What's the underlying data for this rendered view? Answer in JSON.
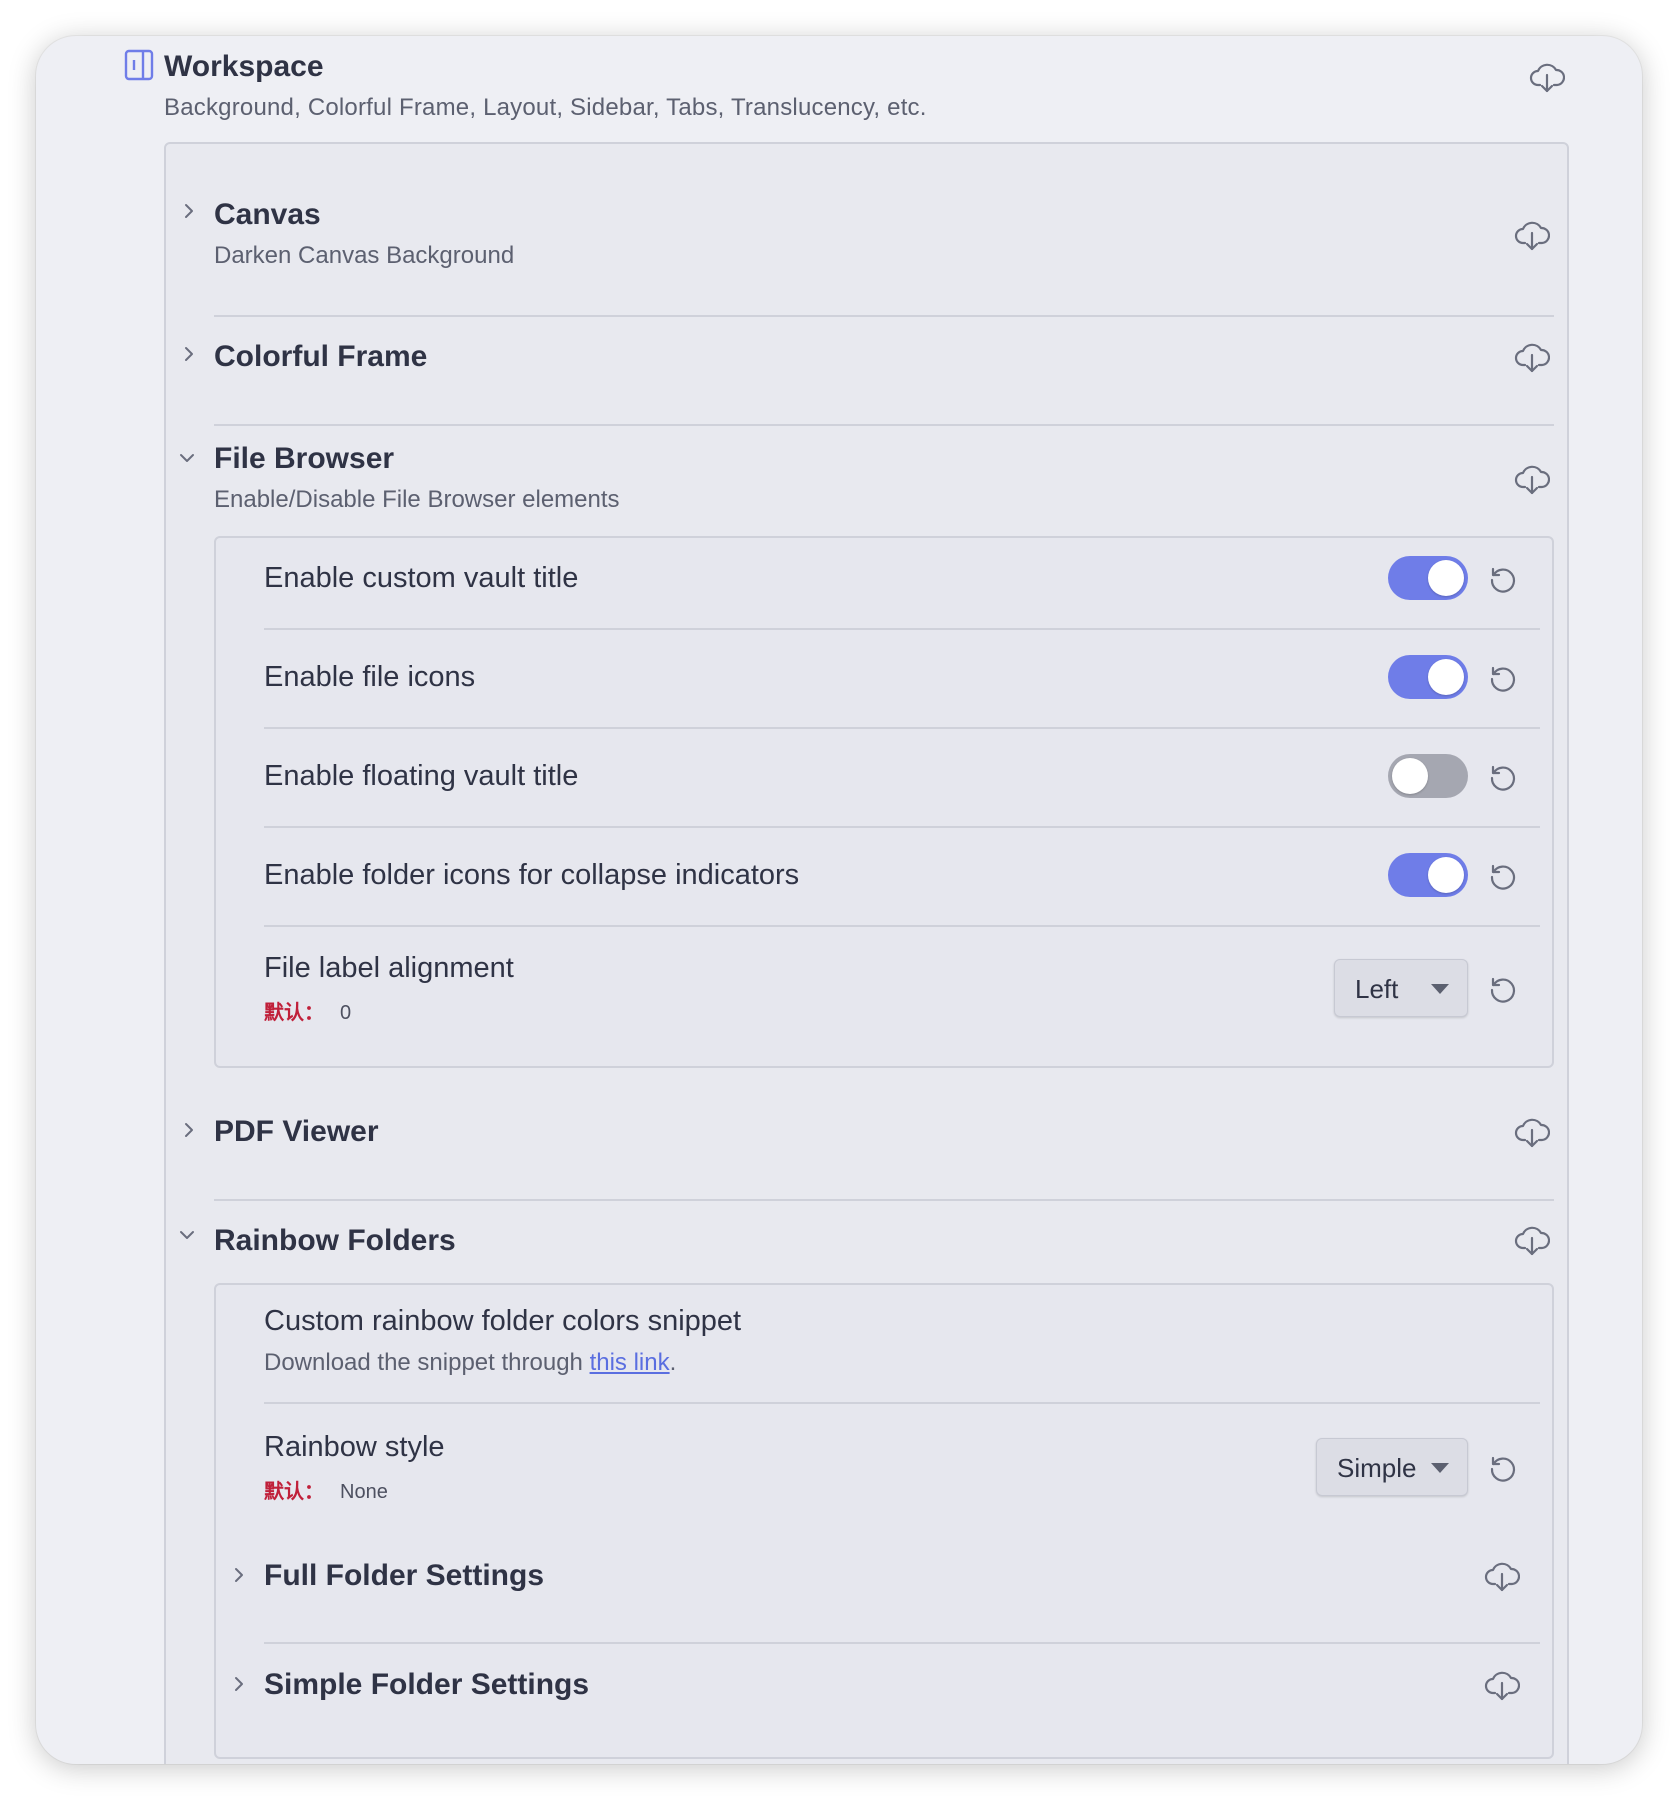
{
  "workspace": {
    "title": "Workspace",
    "description": "Background, Colorful Frame, Layout, Sidebar, Tabs, Translucency, etc.",
    "icon": "sidebar-panel-icon",
    "accent_color": "#6f7de8"
  },
  "sections": {
    "canvas": {
      "title": "Canvas",
      "description": "Darken Canvas Background",
      "expanded": false
    },
    "colorful_frame": {
      "title": "Colorful Frame",
      "expanded": false
    },
    "file_browser": {
      "title": "File Browser",
      "description": "Enable/Disable File Browser elements",
      "expanded": true,
      "settings": {
        "custom_vault_title": {
          "label": "Enable custom vault title",
          "enabled": true
        },
        "file_icons": {
          "label": "Enable file icons",
          "enabled": true
        },
        "floating_vault_title": {
          "label": "Enable floating vault title",
          "enabled": false
        },
        "folder_icons": {
          "label": "Enable folder icons for collapse indicators",
          "enabled": true
        },
        "file_label_alignment": {
          "label": "File label alignment",
          "default_key": "默认：",
          "default_value": "0",
          "selected": "Left"
        }
      }
    },
    "pdf_viewer": {
      "title": "PDF Viewer",
      "expanded": false
    },
    "rainbow_folders": {
      "title": "Rainbow Folders",
      "expanded": true,
      "snippet": {
        "label": "Custom rainbow folder colors snippet",
        "desc_prefix": "Download the snippet through ",
        "link_text": "this link",
        "desc_suffix": "."
      },
      "rainbow_style": {
        "label": "Rainbow style",
        "default_key": "默认：",
        "default_value": "None",
        "selected": "Simple"
      },
      "full_folder": {
        "title": "Full Folder Settings",
        "expanded": false
      },
      "simple_folder": {
        "title": "Simple Folder Settings",
        "expanded": false
      }
    }
  },
  "colors": {
    "toggle_on": "#6f7de8",
    "toggle_off": "#a5a7b1",
    "default_key": "#c0203a",
    "link": "#5a6ee0"
  }
}
